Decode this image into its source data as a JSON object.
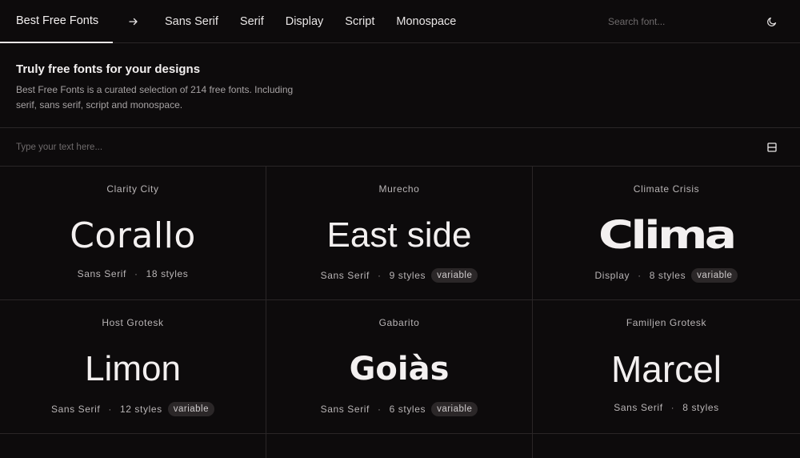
{
  "header": {
    "brand": "Best Free Fonts",
    "nav": [
      "Sans Serif",
      "Serif",
      "Display",
      "Script",
      "Monospace"
    ],
    "search_placeholder": "Search font..."
  },
  "intro": {
    "title": "Truly free fonts for your designs",
    "description": "Best Free Fonts is a curated selection of 214 free fonts. Including serif, sans serif, script and monospace."
  },
  "type_input": {
    "placeholder": "Type your text here..."
  },
  "cards": [
    {
      "font": "Clarity City",
      "preview": "Corallo",
      "category": "Sans Serif",
      "styles": "18 styles",
      "badge": ""
    },
    {
      "font": "Murecho",
      "preview": "East side",
      "category": "Sans Serif",
      "styles": "9 styles",
      "badge": "variable"
    },
    {
      "font": "Climate Crisis",
      "preview": "Clima",
      "category": "Display",
      "styles": "8 styles",
      "badge": "variable"
    },
    {
      "font": "Host Grotesk",
      "preview": "Limon",
      "category": "Sans Serif",
      "styles": "12 styles",
      "badge": "variable"
    },
    {
      "font": "Gabarito",
      "preview": "Goiàs",
      "category": "Sans Serif",
      "styles": "6 styles",
      "badge": "variable"
    },
    {
      "font": "Familjen Grotesk",
      "preview": "Marcel",
      "category": "Sans Serif",
      "styles": "8 styles",
      "badge": ""
    }
  ],
  "separator": "·",
  "icons": {
    "arrow": "arrow-right-icon",
    "theme": "moon-icon",
    "layout": "layout-toggle-icon"
  },
  "colors": {
    "background": "#0d0b0c",
    "text": "#ece9e9",
    "border": "#2a2627",
    "badge_bg": "#2b2728"
  }
}
